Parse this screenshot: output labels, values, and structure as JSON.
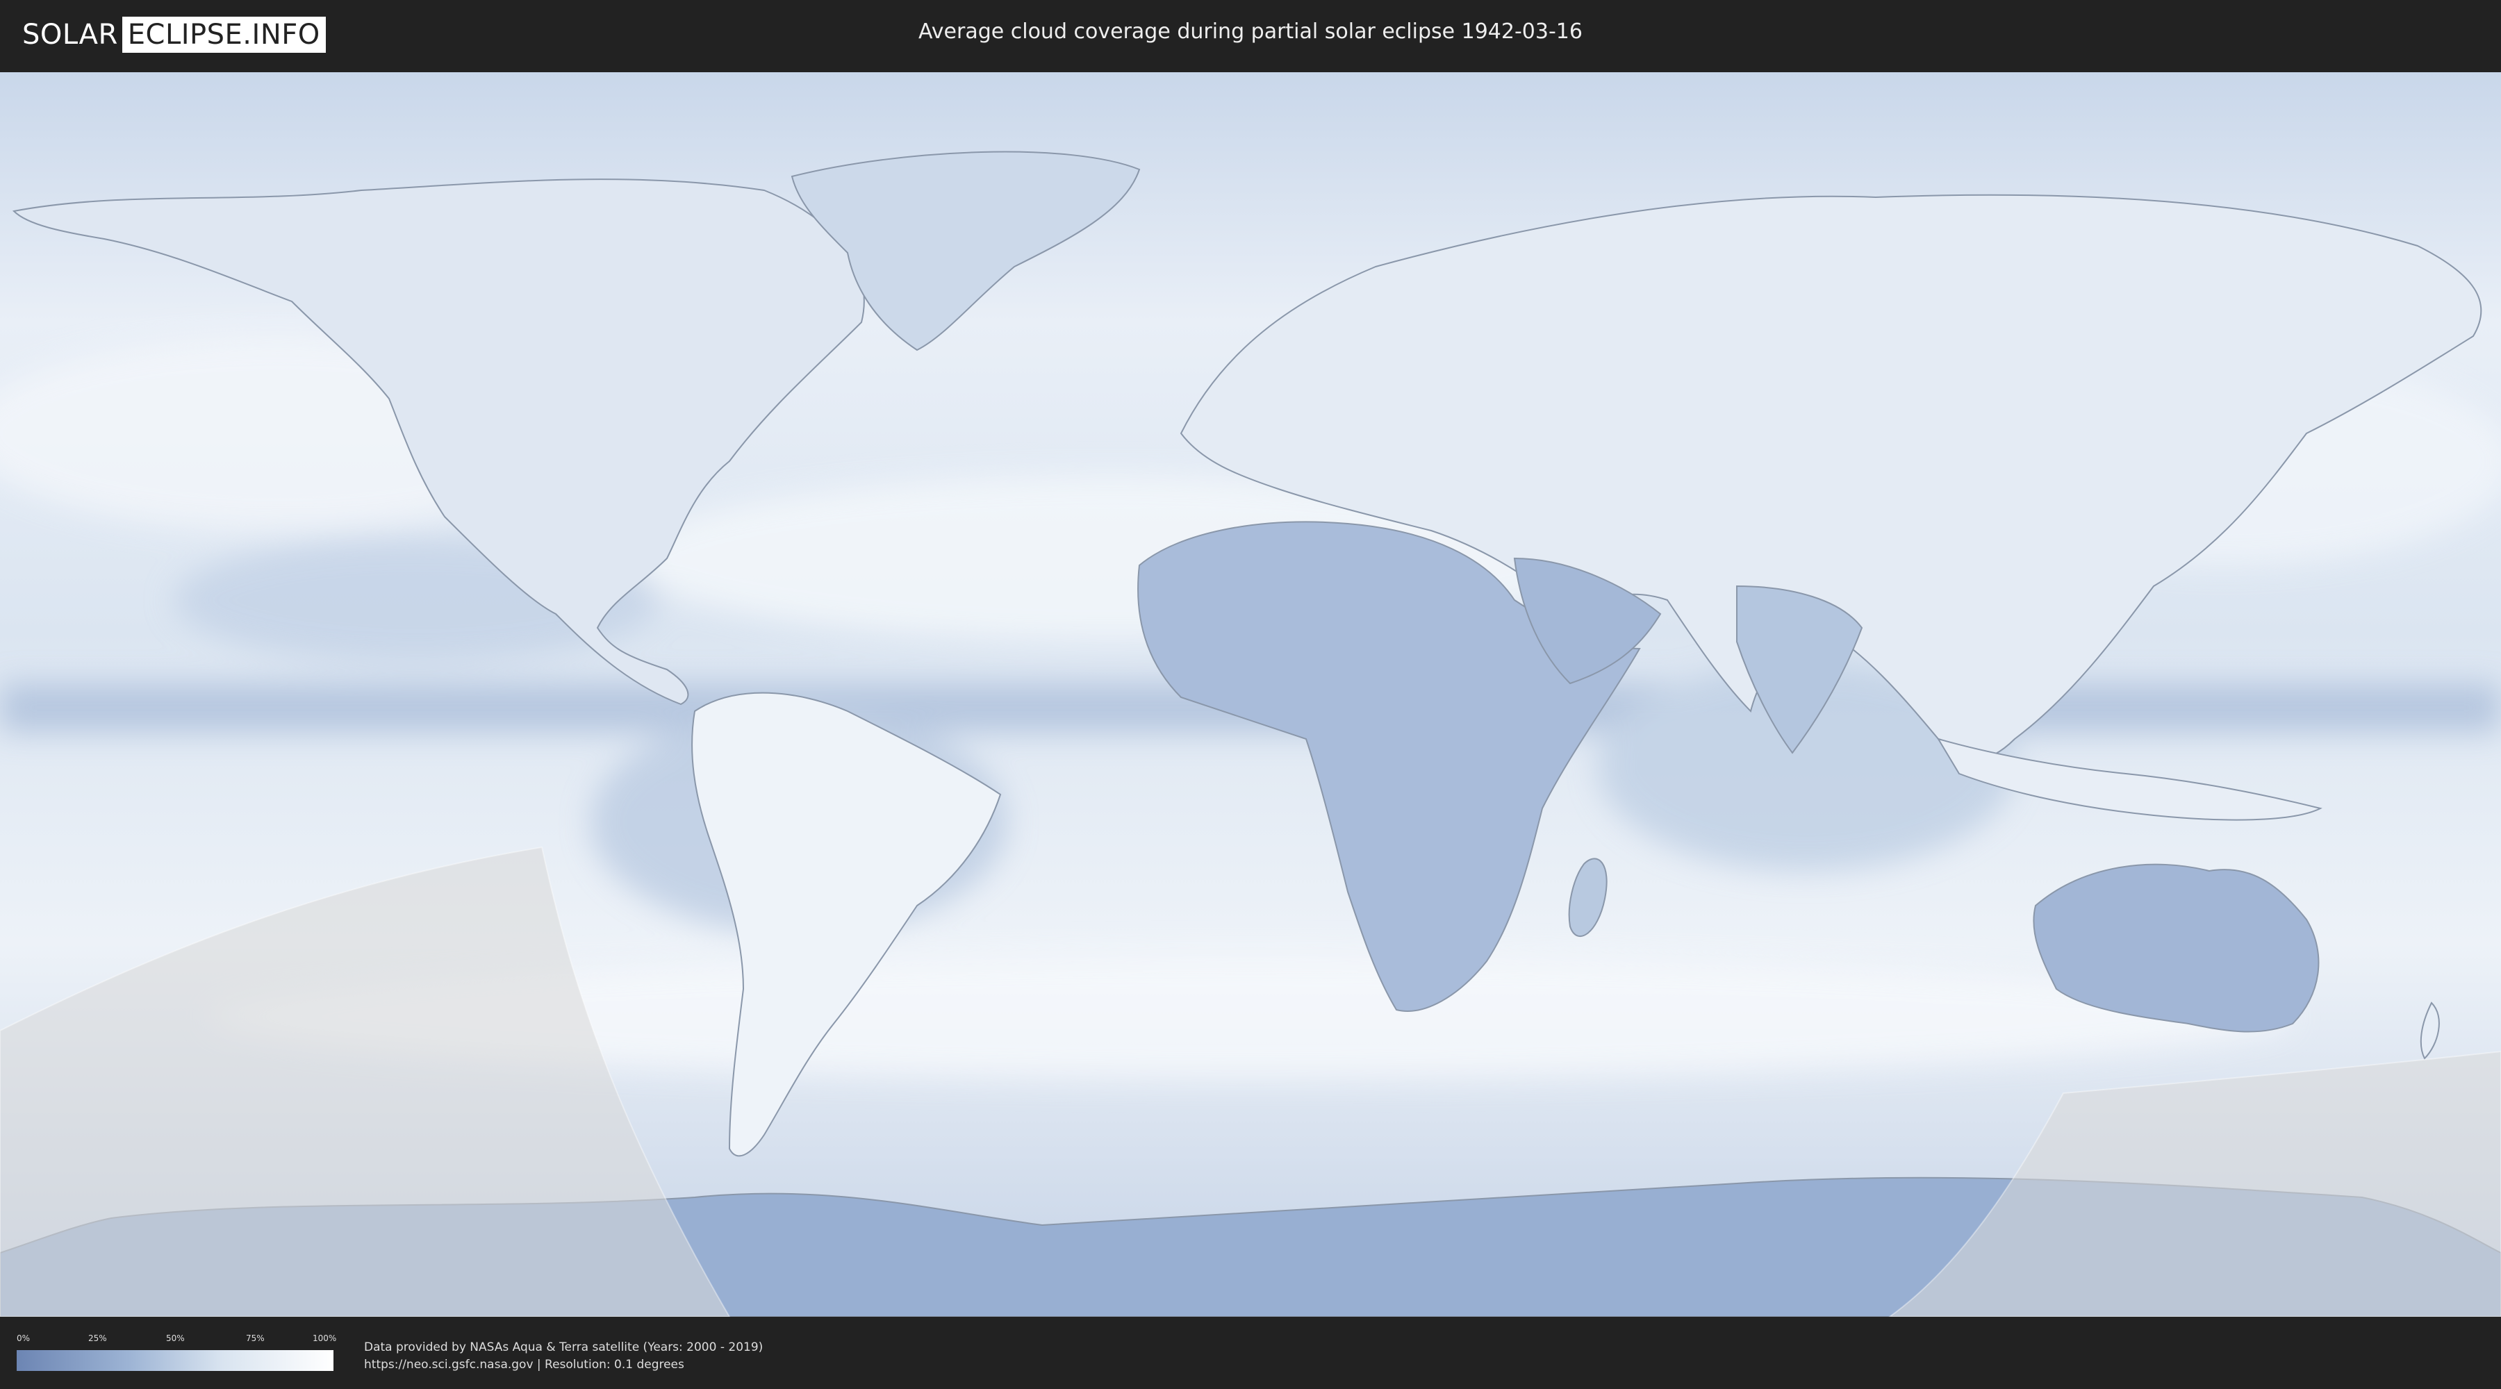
{
  "header": {
    "logo_left": "SOLAR",
    "logo_right": "ECLIPSE.INFO",
    "title": "Average cloud coverage during partial solar eclipse 1942-03-16"
  },
  "legend": {
    "ticks": [
      "0%",
      "25%",
      "50%",
      "75%",
      "100%"
    ],
    "gradient_colors": [
      "#6c85b3",
      "#9cb3d4",
      "#d9e4f0",
      "#ffffff"
    ]
  },
  "credits": {
    "line1": "Data provided by NASAs Aqua & Terra satellite (Years: 2000 - 2019)",
    "line2": "https://neo.sci.gsfc.nasa.gov | Resolution: 0.1 degrees"
  },
  "map": {
    "projection": "equirectangular",
    "colors": {
      "clear_sky": "#6c85b3",
      "cloudy": "#ffffff",
      "land_border": "#8a97aa",
      "eclipse_overlay": "#d8d8d8"
    }
  }
}
